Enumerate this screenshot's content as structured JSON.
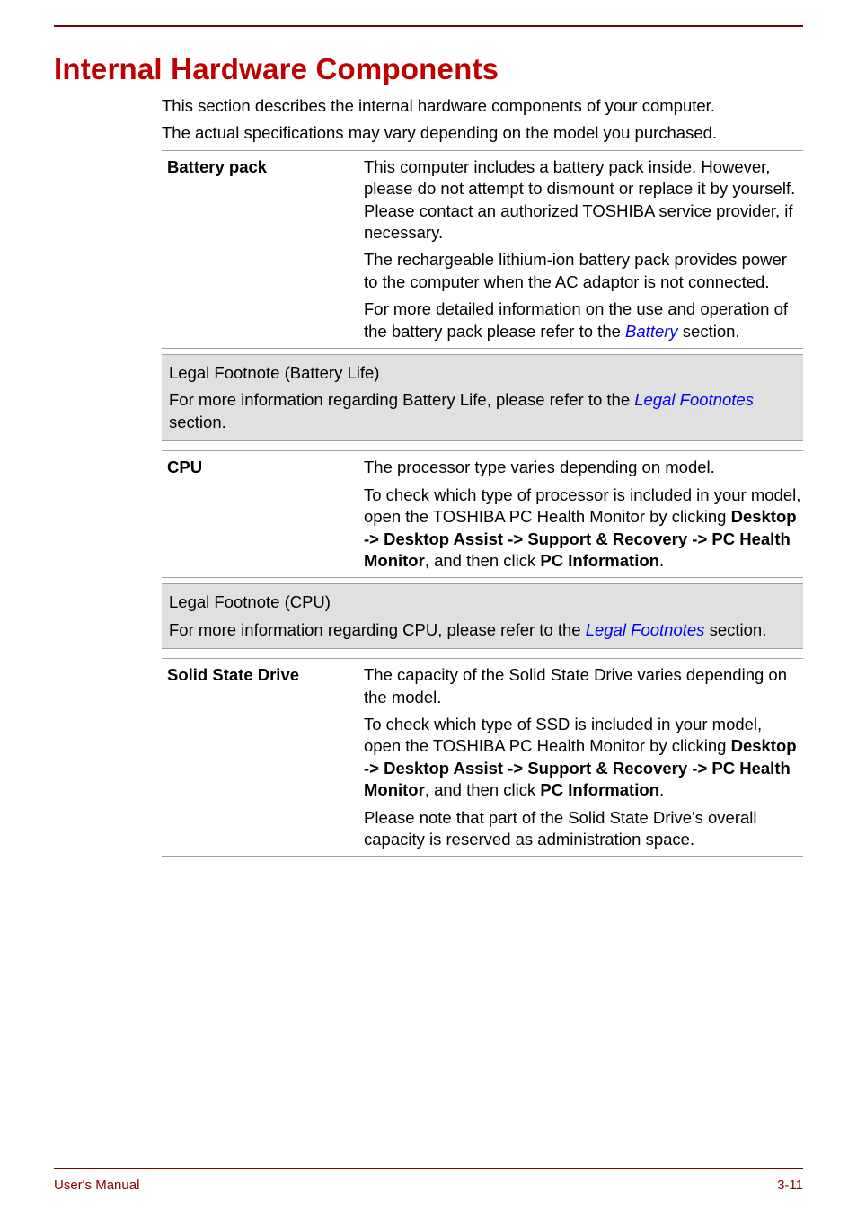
{
  "heading": "Internal Hardware Components",
  "intro": [
    "This section describes the internal hardware components of your computer.",
    "The actual specifications may vary depending on the model you purchased."
  ],
  "battery": {
    "label": "Battery pack",
    "p1a": "This computer includes a battery pack inside. However, please do not attempt to dismount or replace it by yourself. Please contact an authorized TOSHIBA service provider, if necessary.",
    "p2": "The rechargeable lithium-ion battery pack provides power to the computer when the AC adaptor is not connected.",
    "p3a": "For more detailed information on the use and operation of the battery pack please refer to the ",
    "p3link": "Battery",
    "p3b": " section."
  },
  "batteryFootnote": {
    "title": "Legal Footnote (Battery Life)",
    "textA": "For more information regarding Battery Life, please refer to the ",
    "link": "Legal Footnotes",
    "textB": " section."
  },
  "cpu": {
    "label": "CPU",
    "p1": "The processor type varies depending on model.",
    "p2a": "To check which type of processor is included in your model, open the TOSHIBA PC Health Monitor by clicking ",
    "p2b1": "Desktop -> Desktop Assist -> Support & Recovery -> PC Health Monitor",
    "p2c": ", and then click ",
    "p2b2": "PC Information",
    "p2d": "."
  },
  "cpuFootnote": {
    "title": "Legal Footnote (CPU)",
    "textA": "For more information regarding CPU, please refer to the ",
    "link": "Legal Footnotes",
    "textB": " section."
  },
  "ssd": {
    "label": "Solid State Drive",
    "p1": "The capacity of the Solid State Drive varies depending on the model.",
    "p2a": "To check which type of SSD is included in your model, open the TOSHIBA PC Health Monitor by clicking ",
    "p2b1": "Desktop -> Desktop Assist -> Support & Recovery -> PC Health Monitor",
    "p2c": ", and then click ",
    "p2b2": "PC Information",
    "p2d": ".",
    "p3": "Please note that part of the Solid State Drive's overall capacity is reserved as administration space."
  },
  "footer": {
    "left": "User's Manual",
    "right": "3-11"
  }
}
